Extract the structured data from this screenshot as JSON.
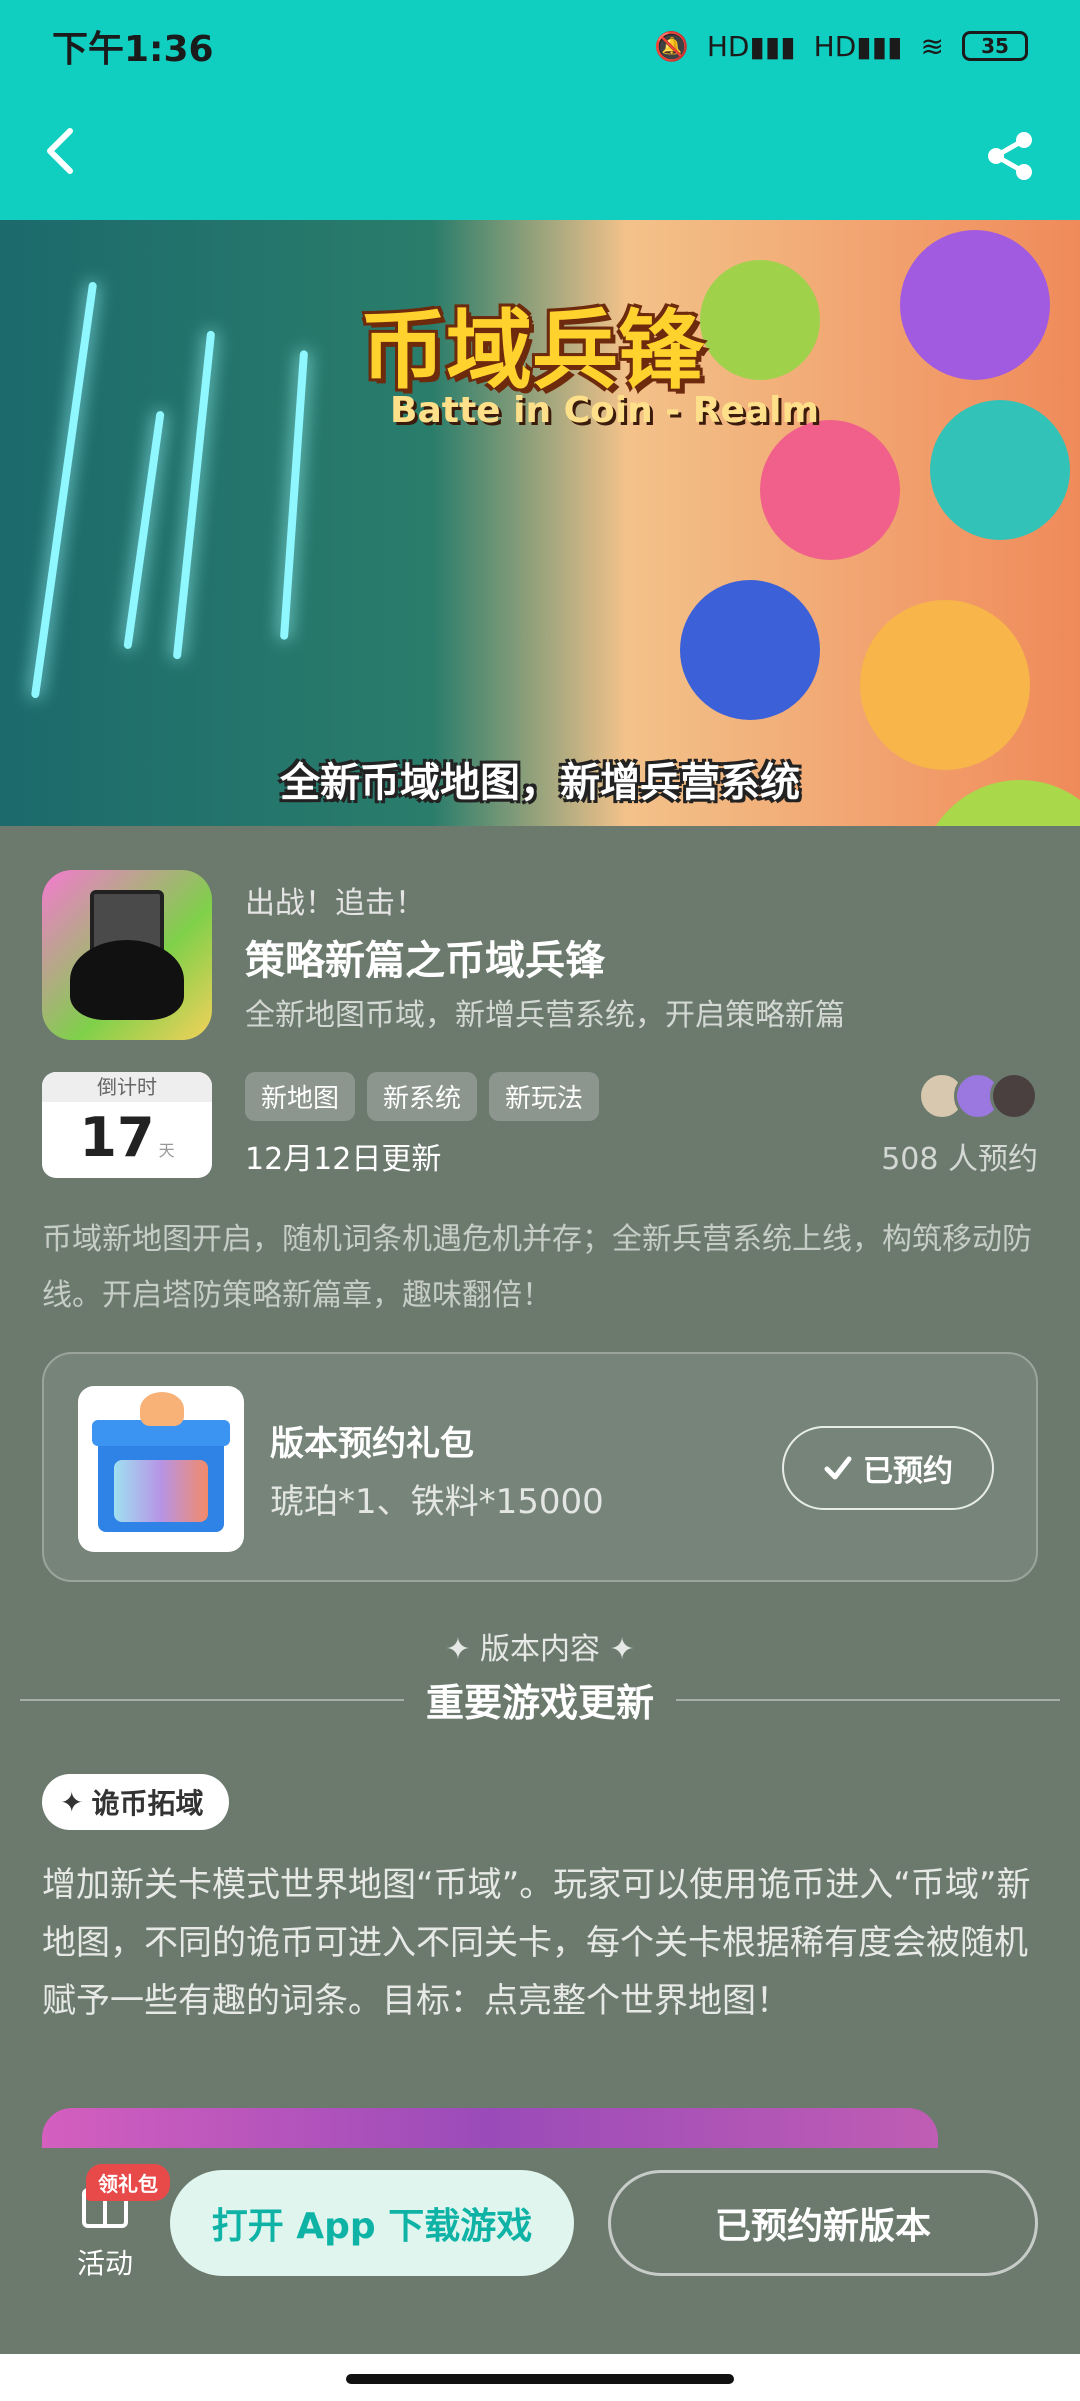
{
  "status_bar": {
    "time": "下午1:36",
    "battery": "35",
    "signal_1": "HD",
    "signal_2": "HD"
  },
  "header": {
    "back_icon": "chevron-left-icon",
    "share_icon": "share-icon"
  },
  "banner": {
    "title": "币域兵锋",
    "subtitle": "Batte in Coin - Realm",
    "caption": "全新币域地图，新增兵营系统"
  },
  "app": {
    "kicker": "出战！追击！",
    "title": "策略新篇之币域兵锋",
    "description": "全新地图币域，新增兵营系统，开启策略新篇",
    "countdown_label": "倒计时",
    "countdown_days": "17",
    "countdown_unit": "天",
    "tags": [
      "新地图",
      "新系统",
      "新玩法"
    ],
    "update_date": "12月12日更新",
    "reserve_count": "508 人预约",
    "summary": "币域新地图开启，随机词条机遇危机并存；全新兵营系统上线，构筑移动防线。开启塔防策略新篇章，趣味翻倍！"
  },
  "gift": {
    "title": "版本预约礼包",
    "description": "琥珀*1、铁料*15000",
    "button_label": "已预约"
  },
  "section": {
    "subtitle": "✦ 版本内容 ✦",
    "title": "重要游戏更新"
  },
  "feature": {
    "tag": "诡币拓域",
    "text": "增加新关卡模式世界地图“币域”。玩家可以使用诡币进入“币域”新地图，不同的诡币可进入不同关卡，每个关卡根据稀有度会被随机赋予一些有趣的词条。目标：点亮整个世界地图！"
  },
  "bottom_bar": {
    "activity_label": "活动",
    "badge": "领礼包",
    "open_app_label": "打开 App 下载游戏",
    "reserved_label": "已预约新版本"
  },
  "colors": {
    "accent": "#10cfc0",
    "background": "#6c7a6e"
  }
}
